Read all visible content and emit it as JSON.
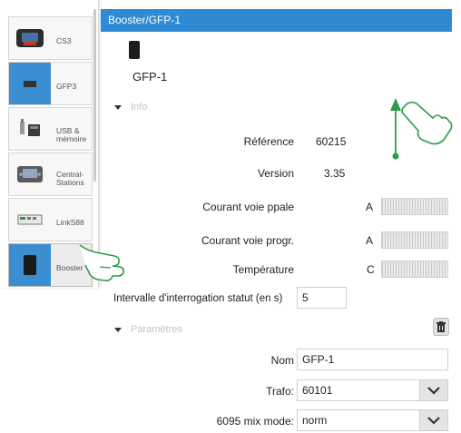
{
  "sidebar": {
    "items": [
      {
        "label": "CS3",
        "icon": "cs3-device-icon"
      },
      {
        "label": "GFP3",
        "icon": "gfp3-device-icon"
      },
      {
        "label": "USB & mémoire",
        "icon": "usb-memory-icon"
      },
      {
        "label": "Central-Stations",
        "icon": "central-station-icon"
      },
      {
        "label": "LinkS88",
        "icon": "links88-icon"
      },
      {
        "label": "Booster",
        "icon": "booster-icon"
      }
    ],
    "selected": "Booster"
  },
  "header": {
    "title": "Booster/GFP-1"
  },
  "device": {
    "name": "GFP-1",
    "icon": "booster-device-icon"
  },
  "info": {
    "section_label": "Info",
    "reference_label": "Référence",
    "reference_value": "60215",
    "version_label": "Version",
    "version_value": "3.35",
    "current_main_label": "Courant voie ppale",
    "current_main_unit": "A",
    "current_prog_label": "Courant voie progr.",
    "current_prog_unit": "A",
    "temperature_label": "Température",
    "temperature_unit": "C",
    "interval_label": "Intervalle d'interrogation statut (en s)",
    "interval_value": "5"
  },
  "params": {
    "section_label": "Paramètres",
    "name_label": "Nom",
    "name_value": "GFP-1",
    "trafo_label": "Trafo:",
    "trafo_value": "60101",
    "mix_label": "6095 mix mode:",
    "mix_value": "norm"
  },
  "colors": {
    "accent": "#2f8ad4",
    "gesture": "#2e9a4a"
  }
}
